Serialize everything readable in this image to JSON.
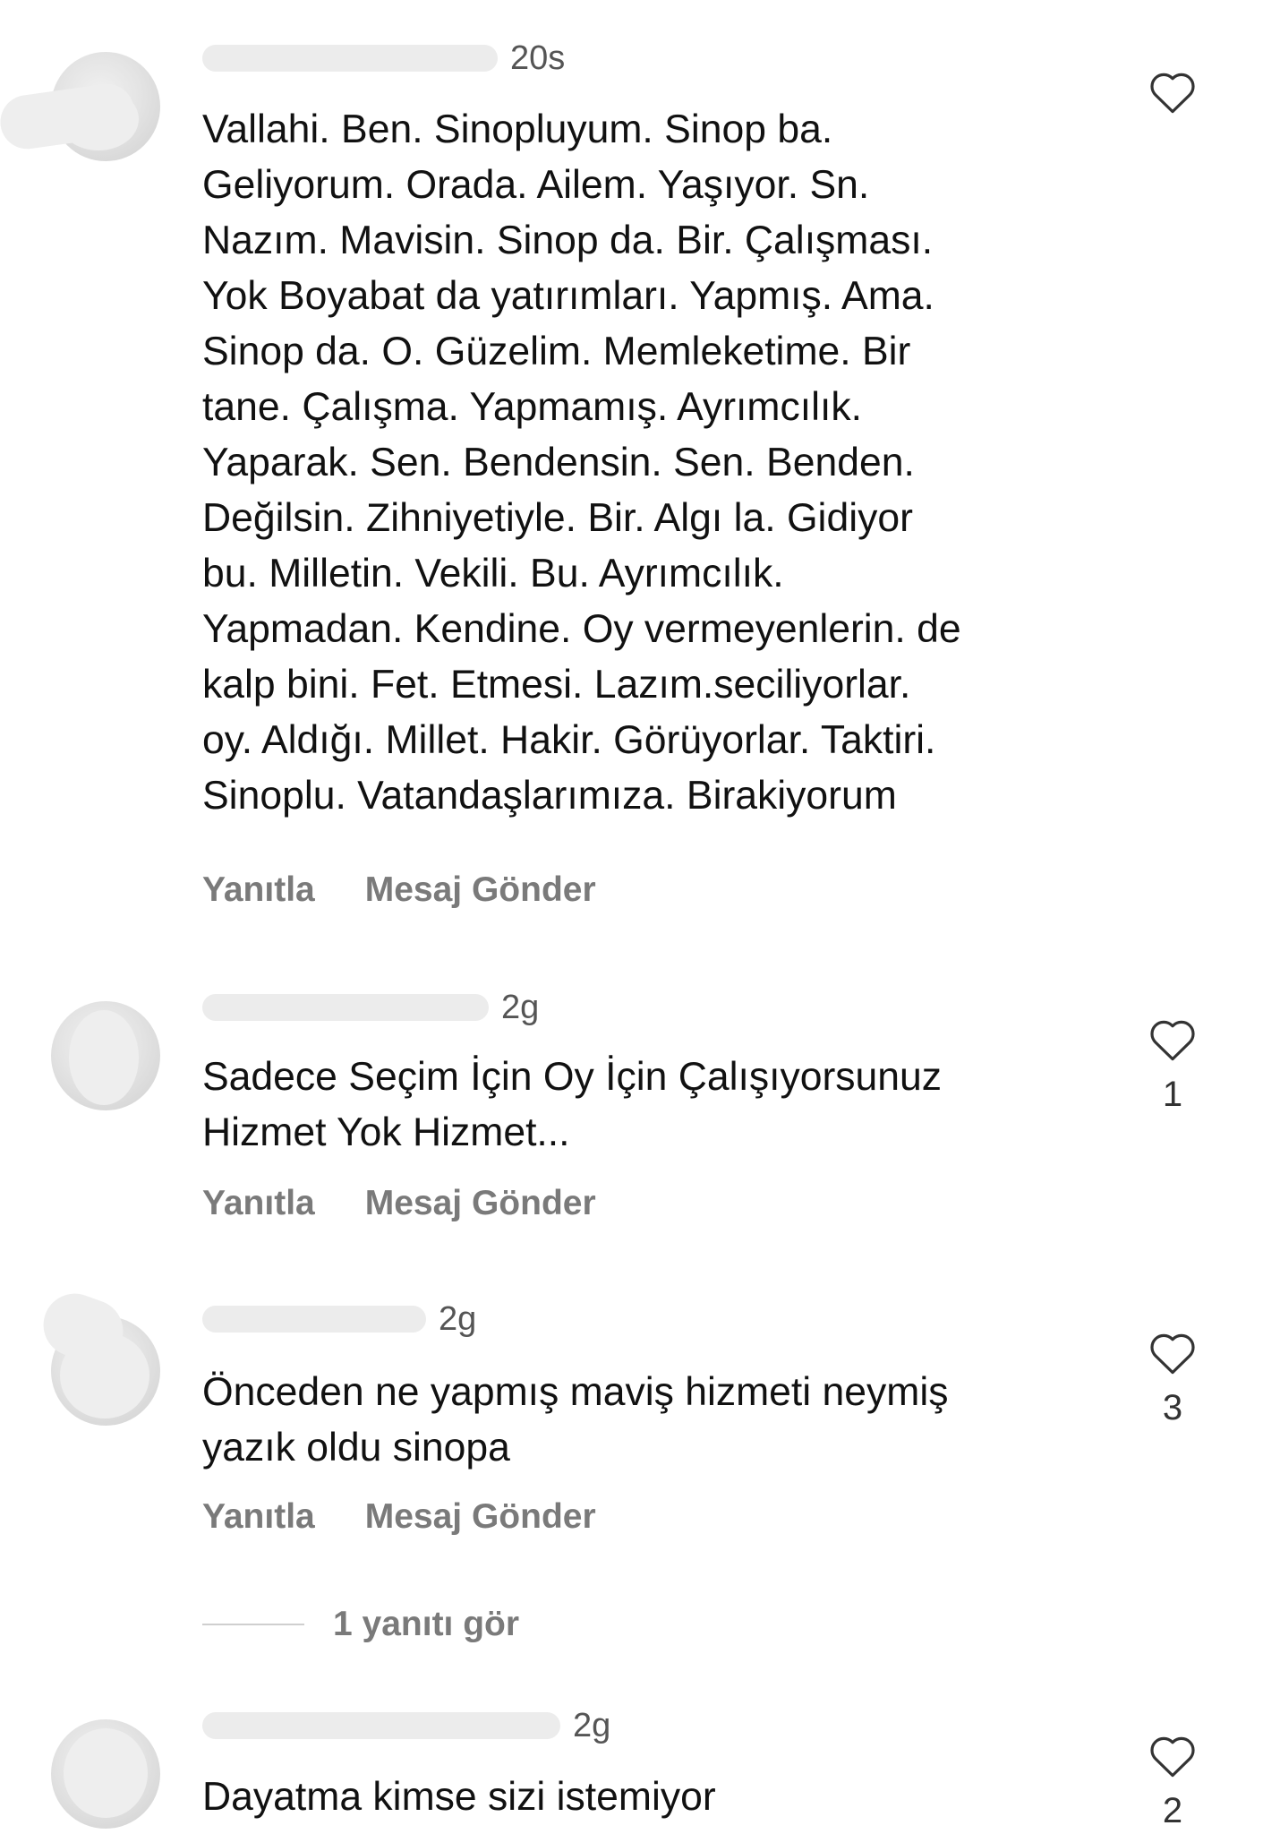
{
  "comments": [
    {
      "username": "",
      "time": "20s",
      "text": "Vallahi. Ben. Sinopluyum. Sinop ba.\nGeliyorum. Orada. Ailem. Yaşıyor. Sn.\nNazım. Mavisin. Sinop da. Bir. Çalışması.\nYok Boyabat  da yatırımları. Yapmış. Ama.\nSinop da. O. Güzelim. Memleketime. Bir\ntane. Çalışma. Yapmamış.  Ayrımcılık.\nYaparak. Sen. Bendensin. Sen. Benden.\nDeğilsin. Zihniyetiyle. Bir. Algı  la. Gidiyor\nbu. Milletin. Vekili. Bu. Ayrımcılık.\nYapmadan. Kendine. Oy vermeyenlerin. de\nkalp bini. Fet. Etmesi. Lazım.seciliyorlar.\noy. Aldığı. Millet. Hakir. Görüyorlar.  Taktiri.\nSinoplu. Vatandaşlarımıza. Birakiyorum",
      "like_count": "",
      "reply_label": "Yanıtla",
      "message_label": "Mesaj Gönder"
    },
    {
      "username": "",
      "time": "2g",
      "text": "Sadece Seçim İçin Oy İçin Çalışıyorsunuz\nHizmet Yok Hizmet...",
      "like_count": "1",
      "reply_label": "Yanıtla",
      "message_label": "Mesaj Gönder"
    },
    {
      "username": "",
      "time": "2g",
      "text": "Önceden ne  yapmış maviş hizmeti neymiş\nyazık oldu sinopa",
      "like_count": "3",
      "reply_label": "Yanıtla",
      "message_label": "Mesaj Gönder"
    },
    {
      "username": "",
      "time": "2g",
      "text": "Dayatma kimse sizi istemiyor",
      "like_count": "2",
      "reply_label": "",
      "message_label": ""
    }
  ],
  "view_replies_label": "1 yanıtı gör",
  "colors": {
    "text": "#111111",
    "secondary": "#7a7a7a",
    "divider": "#cfcfcf",
    "heart_stroke": "#333333"
  },
  "icons": [
    "heart-icon"
  ]
}
